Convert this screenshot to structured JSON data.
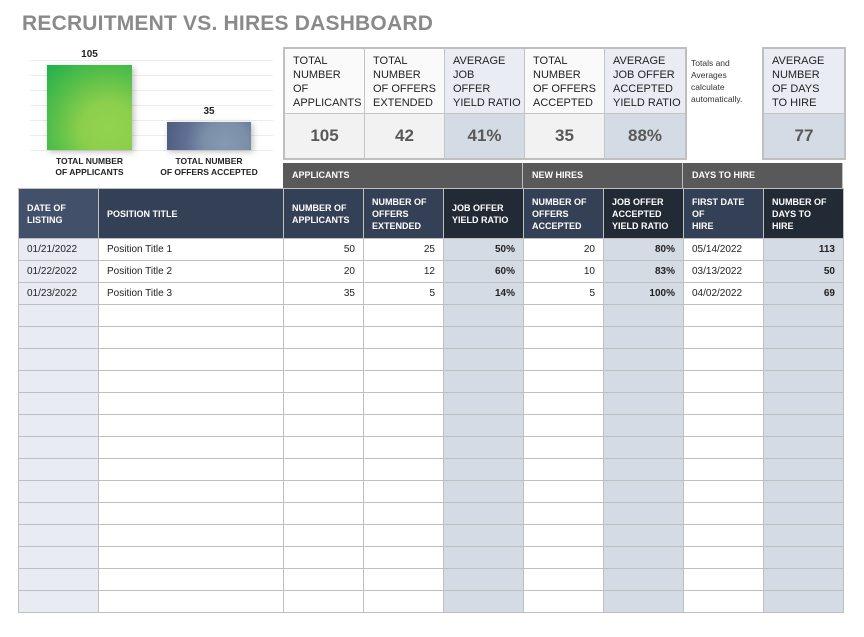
{
  "page": {
    "title": "RECRUITMENT VS. HIRES DASHBOARD"
  },
  "chart_data": {
    "type": "bar",
    "title": "",
    "categories": [
      "TOTAL NUMBER OF APPLICANTS",
      "TOTAL NUMBER OF OFFERS ACCEPTED"
    ],
    "category_lines": [
      [
        "TOTAL NUMBER",
        "OF APPLICANTS"
      ],
      [
        "TOTAL NUMBER",
        "OF OFFERS ACCEPTED"
      ]
    ],
    "values": [
      105,
      35
    ],
    "value_labels": [
      "105",
      "35"
    ],
    "colors": [
      "#5cc04a",
      "#6a7c9c"
    ],
    "ylim": [
      0,
      120
    ],
    "grid": true,
    "xlabel": "",
    "ylabel": ""
  },
  "summary": {
    "cards": [
      {
        "label": "TOTAL NUMBER OF APPLICANTS",
        "lines": [
          "TOTAL",
          "NUMBER",
          "OF",
          "APPLICANTS"
        ],
        "value": "105"
      },
      {
        "label": "TOTAL NUMBER OF OFFERS EXTENDED",
        "lines": [
          "TOTAL",
          "NUMBER",
          "OF OFFERS",
          "EXTENDED"
        ],
        "value": "42"
      },
      {
        "label": "AVERAGE JOB OFFER YIELD RATIO",
        "lines": [
          "AVERAGE",
          "JOB",
          "OFFER",
          "YIELD RATIO"
        ],
        "value": "41%"
      },
      {
        "label": "TOTAL NUMBER OF OFFERS ACCEPTED",
        "lines": [
          "TOTAL",
          "NUMBER",
          "OF OFFERS",
          "ACCEPTED"
        ],
        "value": "35"
      },
      {
        "label": "AVERAGE JOB OFFER ACCEPTED YIELD RATIO",
        "lines": [
          "AVERAGE",
          "JOB OFFER",
          "ACCEPTED",
          "YIELD RATIO"
        ],
        "value": "88%"
      }
    ],
    "days_card": {
      "label": "AVERAGE NUMBER OF DAYS TO HIRE",
      "lines": [
        "AVERAGE",
        "NUMBER",
        "OF DAYS",
        "TO HIRE"
      ],
      "value": "77"
    },
    "note_lines": [
      "Totals and",
      "Averages",
      "calculate",
      "automatically."
    ]
  },
  "groups": [
    "APPLICANTS",
    "NEW HIRES",
    "DAYS TO HIRE"
  ],
  "table": {
    "columns": [
      [
        "DATE OF",
        "LISTING"
      ],
      [
        "POSITION TITLE"
      ],
      [
        "NUMBER OF",
        "APPLICANTS"
      ],
      [
        "NUMBER OF",
        "OFFERS",
        "EXTENDED"
      ],
      [
        "JOB OFFER",
        "YIELD RATIO"
      ],
      [
        "NUMBER OF",
        "OFFERS",
        "ACCEPTED"
      ],
      [
        "JOB OFFER",
        "ACCEPTED",
        "YIELD RATIO"
      ],
      [
        "FIRST DATE OF",
        "HIRE"
      ],
      [
        "NUMBER OF",
        "DAYS TO HIRE"
      ]
    ],
    "rows": [
      [
        "01/21/2022",
        "Position Title 1",
        "50",
        "25",
        "50%",
        "20",
        "80%",
        "05/14/2022",
        "113"
      ],
      [
        "01/22/2022",
        "Position Title 2",
        "20",
        "12",
        "60%",
        "10",
        "83%",
        "03/13/2022",
        "50"
      ],
      [
        "01/23/2022",
        "Position Title 3",
        "35",
        "5",
        "14%",
        "5",
        "100%",
        "04/02/2022",
        "69"
      ]
    ],
    "empty_row_count": 14
  }
}
